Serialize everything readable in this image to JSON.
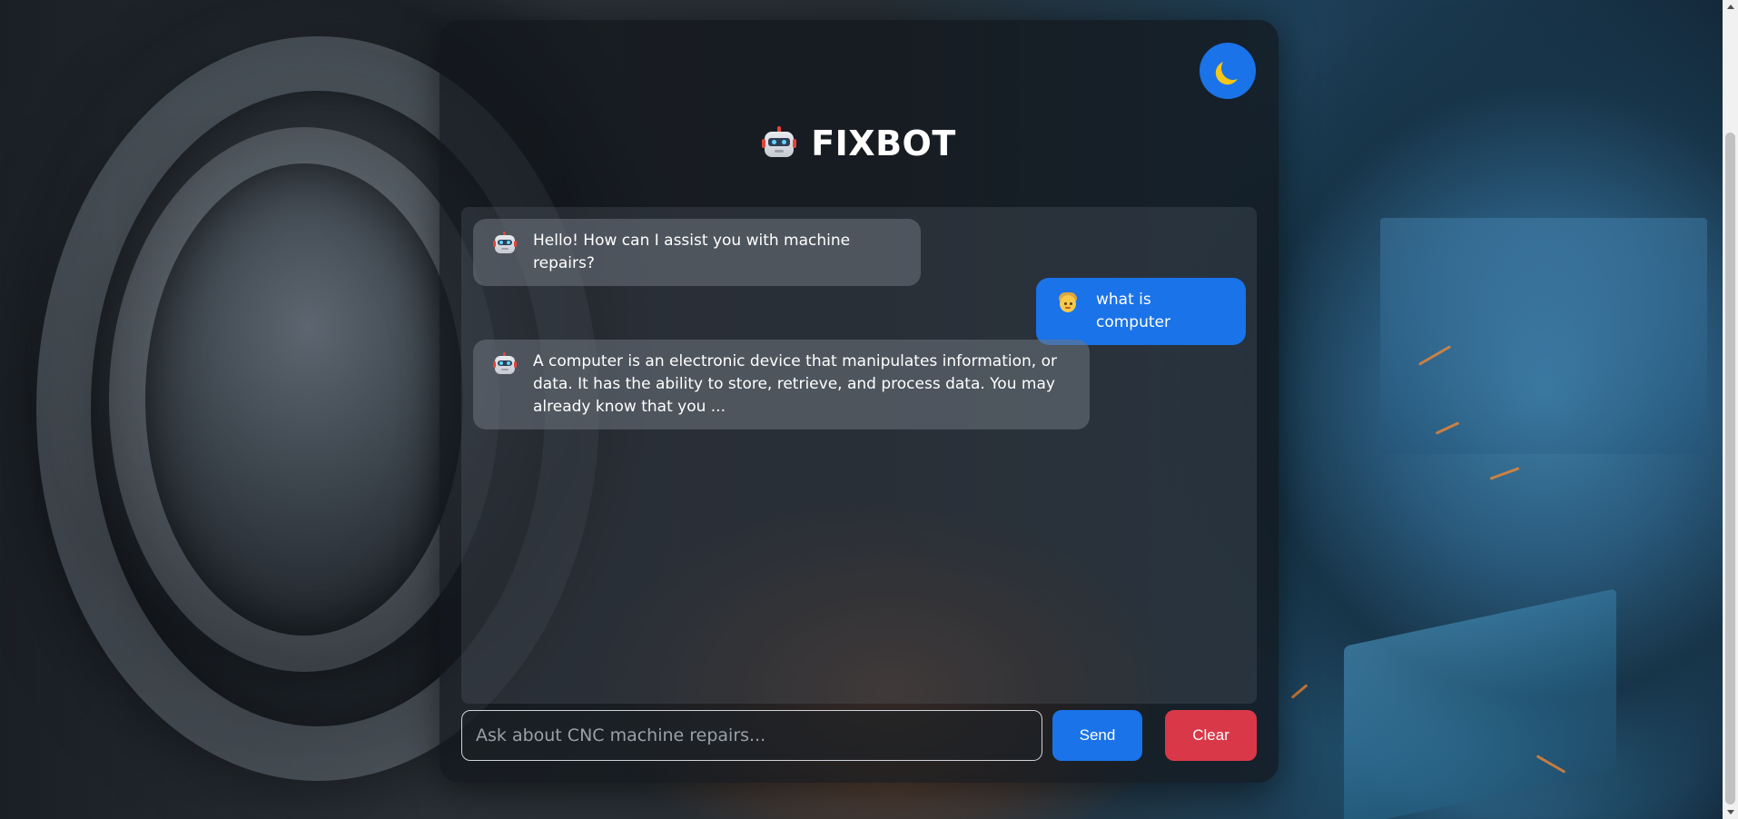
{
  "app": {
    "title": "FIXBOT"
  },
  "theme_toggle": {
    "icon": "moon-icon"
  },
  "messages": [
    {
      "role": "bot",
      "avatar": "robot-icon",
      "text": "Hello! How can I assist you with machine repairs?"
    },
    {
      "role": "user",
      "avatar": "person-icon",
      "text": "what is computer"
    },
    {
      "role": "bot",
      "avatar": "robot-icon",
      "text": "A computer is an electronic device that manipulates information, or data. It has the ability to store, retrieve, and process data. You may already know that you ..."
    }
  ],
  "input": {
    "placeholder": "Ask about CNC machine repairs...",
    "value": ""
  },
  "buttons": {
    "send_label": "Send",
    "clear_label": "Clear"
  },
  "colors": {
    "accent": "#1a73e8",
    "danger": "#d93848",
    "panel": "#12161c"
  }
}
